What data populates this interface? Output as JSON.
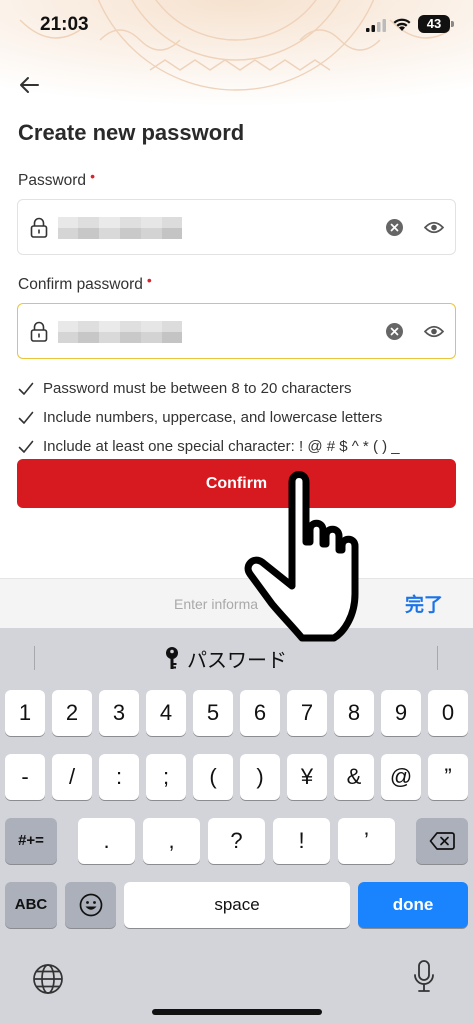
{
  "status_bar": {
    "time": "21:03",
    "battery": "43"
  },
  "page": {
    "title": "Create new password"
  },
  "form": {
    "password_label": "Password",
    "confirm_label": "Confirm password",
    "required_mark": "•"
  },
  "rules": [
    "Password must be between 8 to 20 characters",
    "Include numbers, uppercase, and lowercase letters",
    "Include at least one special character: ! @ # $ ^ * ( ) _"
  ],
  "confirm_button": "Confirm",
  "accessory": {
    "placeholder": "Enter informa",
    "done": "完了"
  },
  "keyboard": {
    "suggestion": "パスワード",
    "row1": [
      "1",
      "2",
      "3",
      "4",
      "5",
      "6",
      "7",
      "8",
      "9",
      "0"
    ],
    "row2": [
      "-",
      "/",
      ":",
      ";",
      "(",
      ")",
      "¥",
      "&",
      "@",
      "”"
    ],
    "row3": [
      ".",
      ",",
      "?",
      "!",
      "’"
    ],
    "shift_label": "#+=",
    "abc_label": "ABC",
    "space_label": "space",
    "done_label": "done"
  },
  "colors": {
    "brand_red": "#d71920",
    "focus_yellow": "#e8c53a",
    "ios_blue": "#1a84ff"
  }
}
